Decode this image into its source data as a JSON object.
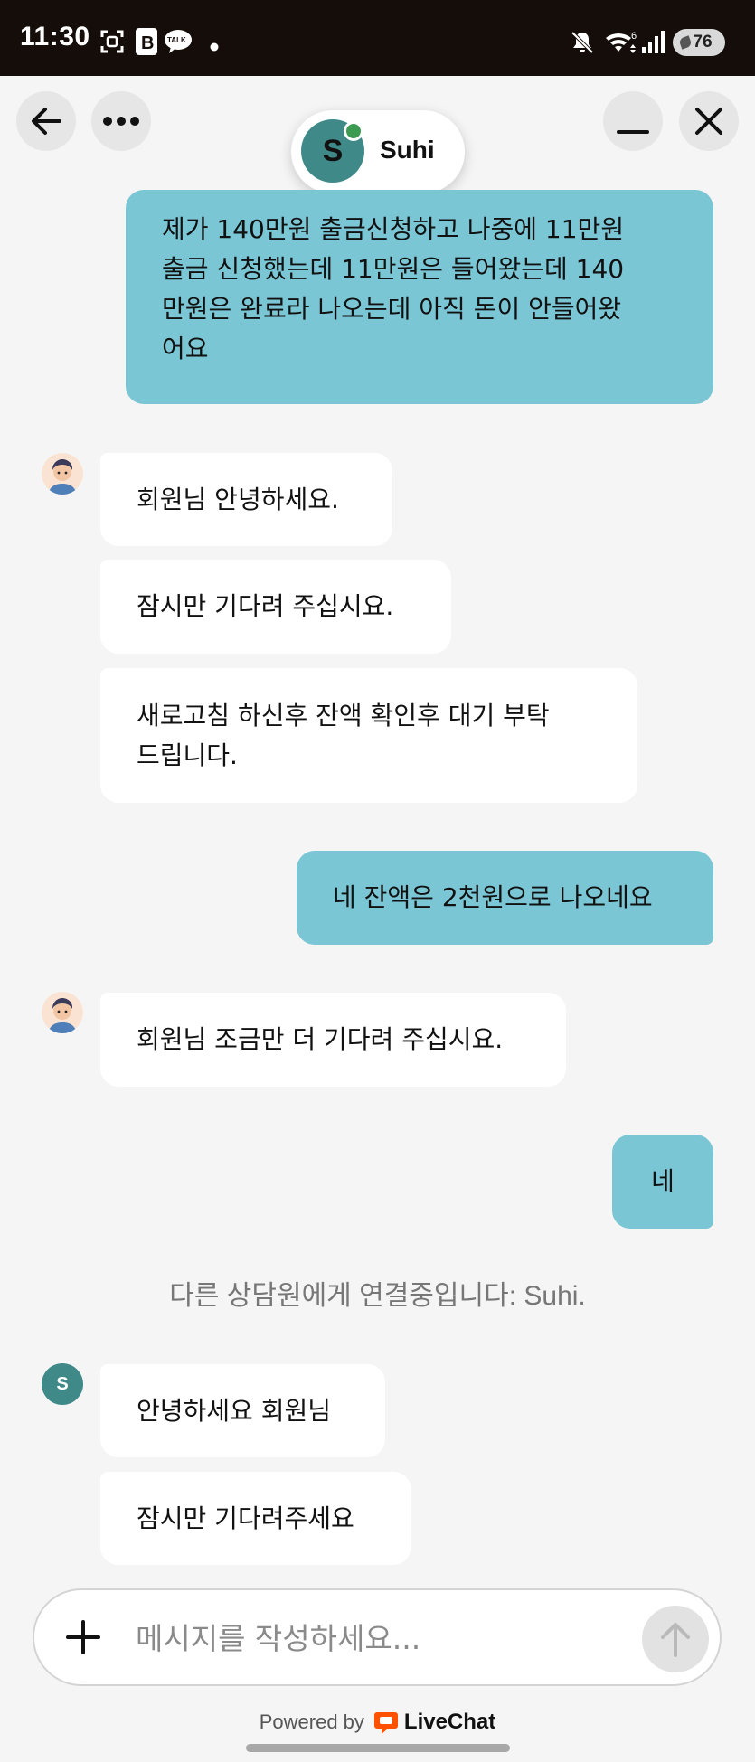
{
  "status_bar": {
    "time": "11:30",
    "battery": "76",
    "left_icons": [
      "screenshot-icon",
      "b-app-icon",
      "kakaotalk-icon",
      "dot-icon"
    ],
    "right_icons": [
      "mute-icon",
      "wifi-icon",
      "signal-icon",
      "battery-icon"
    ],
    "kakao_label": "TALK",
    "wifi_label": "6"
  },
  "header": {
    "agent_name": "Suhi",
    "agent_initial": "S",
    "online_color": "#3d9b51",
    "avatar_color": "#3f8a88"
  },
  "messages": {
    "user_1_lines": [
      "제가 140만원 출금신청하고 나중에 11만원",
      "출금 신청했는데 11만원은 들어왔는데 140",
      "만원은 완료라 나오는데 아직 돈이 안들어왔",
      "어요"
    ],
    "agent_1a": "회원님 안녕하세요.",
    "agent_1b": "잠시만 기다려 주십시요.",
    "agent_1c_lines": [
      "새로고침 하신후 잔액 확인후 대기 부탁",
      "드립니다."
    ],
    "user_2": "네 잔액은 2천원으로 나오네요",
    "agent_2": "회원님 조금만 더 기다려 주십시요.",
    "user_3": "네",
    "system": "다른 상담원에게 연결중입니다: Suhi.",
    "suhi_initial": "S",
    "agent_3a": "안녕하세요 회원님",
    "agent_3b": "잠시만 기다려주세요"
  },
  "composer": {
    "placeholder": "메시지를 작성하세요..."
  },
  "footer": {
    "powered_by": "Powered by",
    "brand": "LiveChat",
    "brand_color": "#ff5100"
  },
  "colors": {
    "user_bubble": "#7bc6d5",
    "agent_bubble": "#ffffff",
    "background": "#f5f5f5"
  }
}
